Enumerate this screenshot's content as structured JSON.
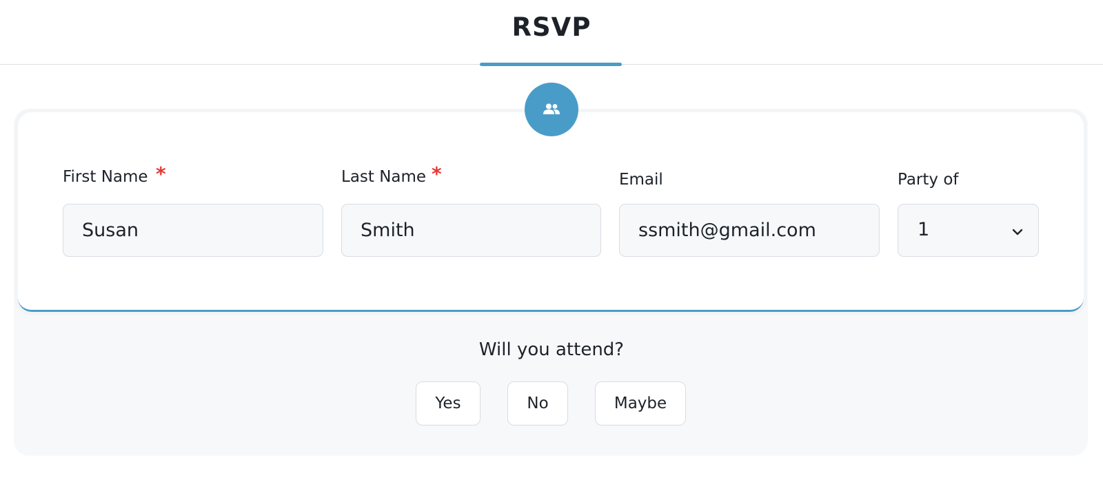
{
  "header": {
    "title": "RSVP"
  },
  "form": {
    "icon": "users-icon",
    "first_name": {
      "label": "First Name",
      "required_mark": "*",
      "value": "Susan"
    },
    "last_name": {
      "label": "Last Name",
      "required_mark": "*",
      "value": "Smith"
    },
    "email": {
      "label": "Email",
      "value": "ssmith@gmail.com"
    },
    "party": {
      "label": "Party of",
      "value": "1"
    }
  },
  "attendance": {
    "question": "Will you attend?",
    "options": [
      "Yes",
      "No",
      "Maybe"
    ]
  },
  "colors": {
    "accent": "#4a9cc8",
    "required": "#e53935"
  }
}
